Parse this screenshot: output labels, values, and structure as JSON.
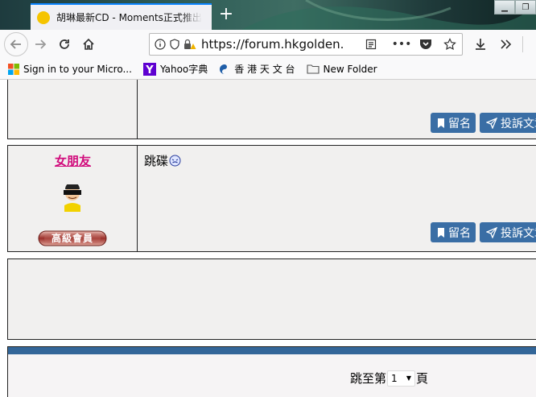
{
  "browser": {
    "tab_title": "胡琳最新CD - Moments正式推出",
    "url": "https://forum.hkgolden.com",
    "bookmarks": [
      {
        "label": "Sign in to your Micro...",
        "icon": "microsoft-icon"
      },
      {
        "label": "Yahoo字典",
        "icon": "yahoo-icon"
      },
      {
        "label": "香 港 天 文 台",
        "icon": "hko-icon"
      },
      {
        "label": "New Folder",
        "icon": "folder-icon"
      }
    ]
  },
  "posts": [
    {
      "buttons": {
        "bookmark": "留名",
        "report": "投訴文章"
      }
    },
    {
      "username": "女朋友",
      "member_badge": "高級會員",
      "message": "跳碟",
      "buttons": {
        "bookmark": "留名",
        "report": "投訴文章"
      }
    }
  ],
  "footer": {
    "jump_prefix": "跳至第",
    "page_value": "1",
    "jump_suffix": "頁"
  },
  "colors": {
    "button_bg": "#3a6ea5",
    "username": "#d10c7c",
    "footer_bar": "#336699",
    "post_bg": "#f1f0ef"
  }
}
